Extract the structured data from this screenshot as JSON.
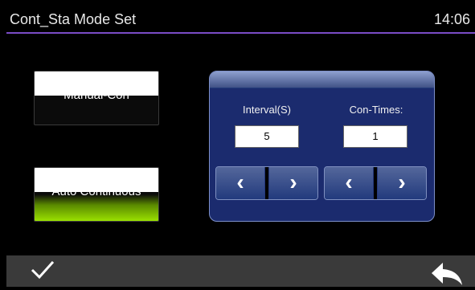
{
  "header": {
    "title": "Cont_Sta Mode Set",
    "time": "14:06"
  },
  "modes": {
    "manual_label": "Manual-Con",
    "auto_label": "Auto Continuous"
  },
  "panel": {
    "interval_label": "Interval(S)",
    "interval_value": "5",
    "con_times_label": "Con-Times:",
    "con_times_value": "1"
  },
  "arrows": {
    "left": "‹",
    "right": "›"
  },
  "footer": {
    "confirm_icon": "checkmark-icon",
    "back_icon": "back-arrow-icon"
  },
  "colors": {
    "accent": "#7a4cc7",
    "panel_bg": "#1b2b6e",
    "active_green": "#9ae000"
  }
}
